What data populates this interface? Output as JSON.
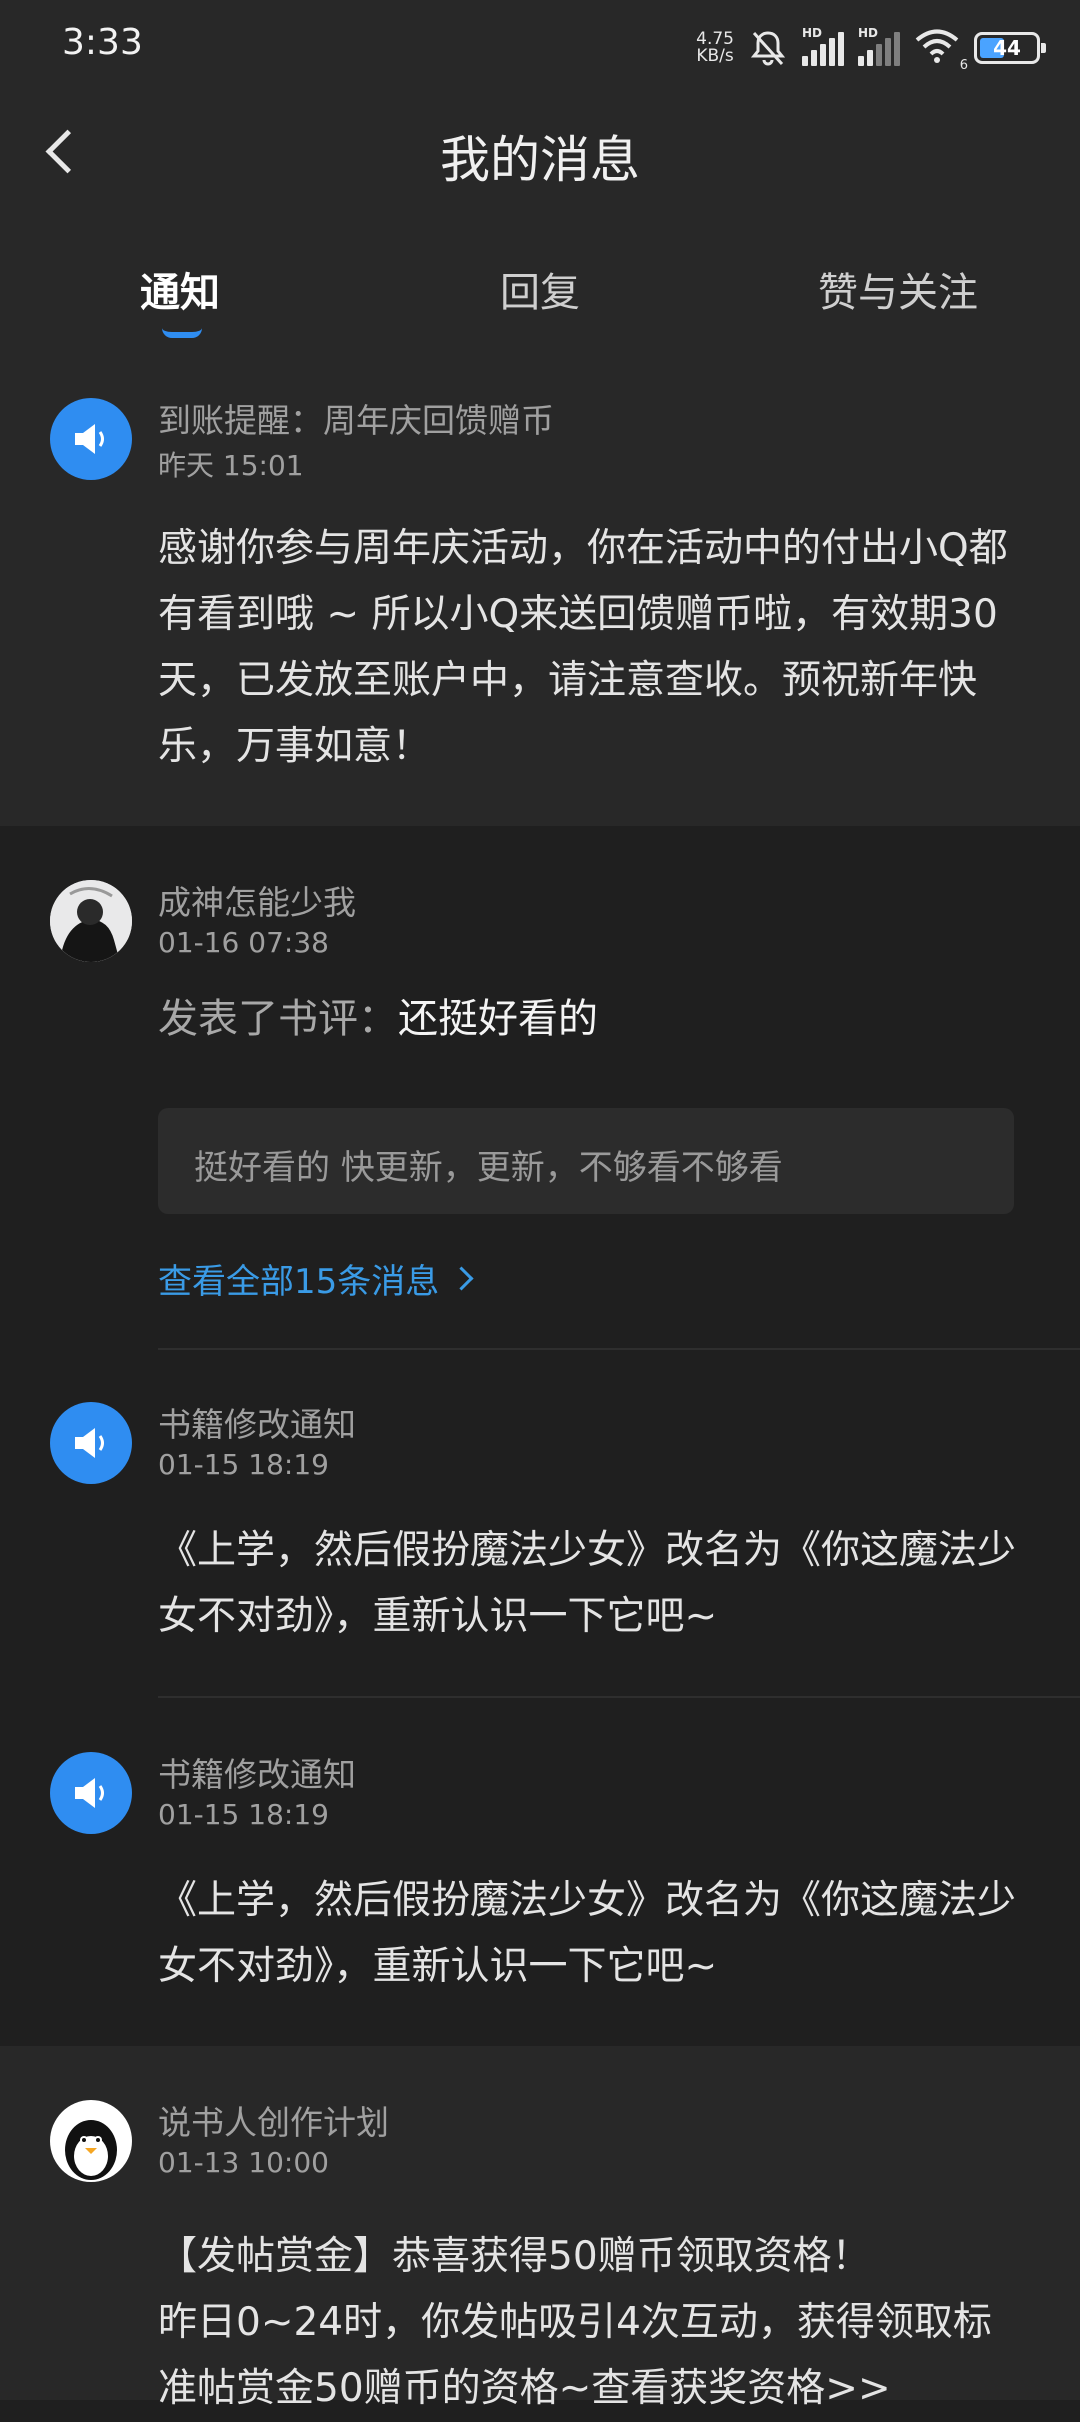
{
  "status_bar": {
    "time": "3:33",
    "net_speed_value": "4.75",
    "net_speed_unit": "KB/s",
    "hd_label": "HD",
    "wifi_slot": "6",
    "battery": "44"
  },
  "header": {
    "title": "我的消息"
  },
  "tabs": [
    {
      "label": "通知",
      "active": true
    },
    {
      "label": "回复",
      "active": false
    },
    {
      "label": "赞与关注",
      "active": false
    }
  ],
  "messages": {
    "m1": {
      "sender": "到账提醒：周年庆回馈赠币",
      "time": "昨天 15:01",
      "body": "感谢你参与周年庆活动，你在活动中的付出小Q都有看到哦 ~ 所以小Q来送回馈赠币啦，有效期30天，已发放至账户中，请注意查收。预祝新年快乐，万事如意！"
    },
    "m2": {
      "sender": "成神怎能少我",
      "time": "01-16 07:38",
      "action": "发表了书评：",
      "review_title": "还挺好看的",
      "quote": "挺好看的 快更新，更新，不够看不够看",
      "view_all": "查看全部15条消息"
    },
    "m3": {
      "sender": "书籍修改通知",
      "time": "01-15 18:19",
      "body": "《上学，然后假扮魔法少女》改名为《你这魔法少女不对劲》，重新认识一下它吧~"
    },
    "m4": {
      "sender": "书籍修改通知",
      "time": "01-15 18:19",
      "body": "《上学，然后假扮魔法少女》改名为《你这魔法少女不对劲》，重新认识一下它吧~"
    },
    "m5": {
      "sender": "说书人创作计划",
      "time": "01-13 10:00",
      "body_line1": "【发帖赏金】恭喜获得50赠币领取资格！",
      "body_line2": "昨日0~24时，你发帖吸引4次互动，获得领取标准帖赏金50赠币的资格~查看获奖资格>>"
    }
  },
  "colors": {
    "accent": "#2f8df1",
    "link": "#3a9be6",
    "page_bg": "#1f1f1f",
    "card_bg": "#282828"
  }
}
